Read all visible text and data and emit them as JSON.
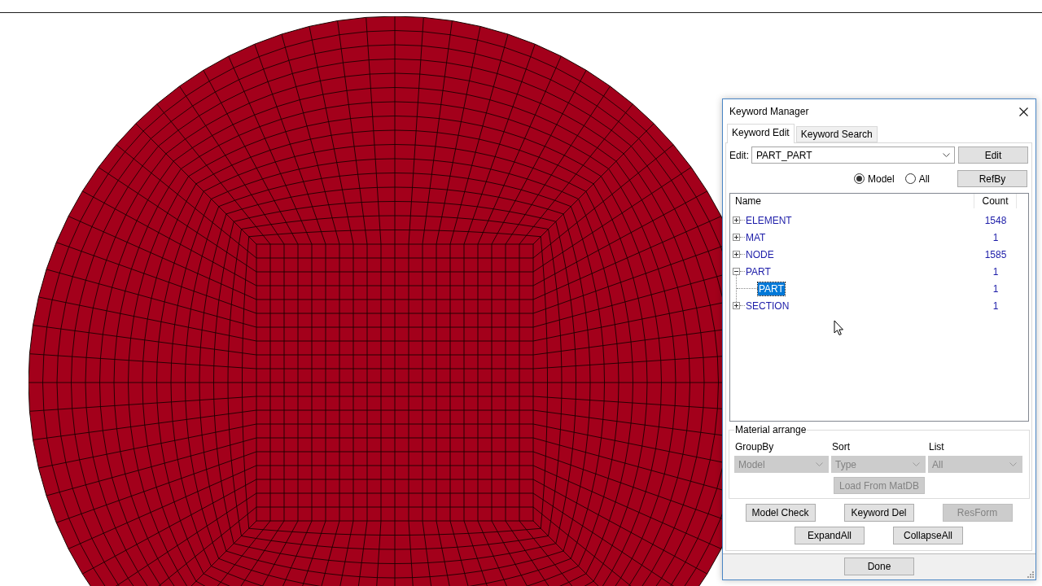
{
  "dialog": {
    "title": "Keyword Manager"
  },
  "tabs": [
    {
      "label": "Keyword Edit",
      "selected": true
    },
    {
      "label": "Keyword Search",
      "selected": false
    }
  ],
  "edit": {
    "label": "Edit:",
    "value": "PART_PART",
    "button": "Edit"
  },
  "scope": {
    "options": [
      {
        "label": "Model",
        "selected": true
      },
      {
        "label": "All",
        "selected": false
      }
    ],
    "button": "RefBy"
  },
  "tree": {
    "columns": [
      "Name",
      "Count"
    ],
    "items": [
      {
        "name": "ELEMENT",
        "count": "1548",
        "expanded": false,
        "selected": false
      },
      {
        "name": "MAT",
        "count": "1",
        "expanded": false,
        "selected": false
      },
      {
        "name": "NODE",
        "count": "1585",
        "expanded": false,
        "selected": false
      },
      {
        "name": "PART",
        "count": "1",
        "expanded": true,
        "selected": false,
        "children": [
          {
            "name": "PART",
            "count": "1",
            "selected": true
          }
        ]
      },
      {
        "name": "SECTION",
        "count": "1",
        "expanded": false,
        "selected": false
      }
    ]
  },
  "material_arrange": {
    "title": "Material arrange",
    "fields": [
      {
        "label": "GroupBy",
        "value": "Model",
        "disabled": true
      },
      {
        "label": "Sort",
        "value": "Type",
        "disabled": true
      },
      {
        "label": "List",
        "value": "All",
        "disabled": true
      }
    ],
    "load_button": {
      "label": "Load From MatDB",
      "disabled": true
    }
  },
  "action_rows": [
    {
      "buttons": [
        {
          "label": "Model Check",
          "disabled": false
        },
        {
          "label": "Keyword Del",
          "disabled": false
        },
        {
          "label": "ResForm",
          "disabled": true
        }
      ]
    },
    {
      "buttons": [
        {
          "label": "ExpandAll",
          "disabled": false
        },
        {
          "label": "CollapseAll",
          "disabled": false
        }
      ]
    }
  ],
  "footer": {
    "button": "Done"
  }
}
